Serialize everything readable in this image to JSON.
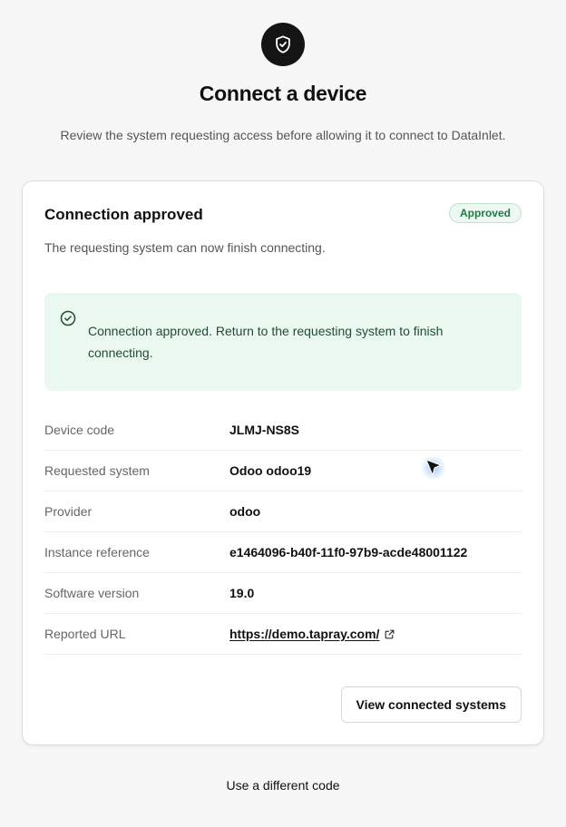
{
  "header": {
    "logo_icon": "shield-check-icon",
    "title": "Connect a device",
    "subtitle": "Review the system requesting access before allowing it to connect to DataInlet."
  },
  "card": {
    "title": "Connection approved",
    "badge": "Approved",
    "description": "The requesting system can now finish connecting.",
    "alert": {
      "icon": "check-circle-icon",
      "message": "Connection approved. Return to the requesting system to finish connecting."
    },
    "details": [
      {
        "label": "Device code",
        "value": "JLMJ-NS8S"
      },
      {
        "label": "Requested system",
        "value": "Odoo odoo19"
      },
      {
        "label": "Provider",
        "value": "odoo"
      },
      {
        "label": "Instance reference",
        "value": "e1464096-b40f-11f0-97b9-acde48001122"
      },
      {
        "label": "Software version",
        "value": "19.0"
      },
      {
        "label": "Reported URL",
        "value": "https://demo.tapray.com/",
        "icon": "external-link-icon"
      }
    ],
    "view_button": "View connected systems"
  },
  "footer": {
    "link": "Use a different code"
  },
  "colors": {
    "background": "#f7f7f7",
    "badge_green": "#1e7a45",
    "alert_background": "#ebf8f0"
  }
}
